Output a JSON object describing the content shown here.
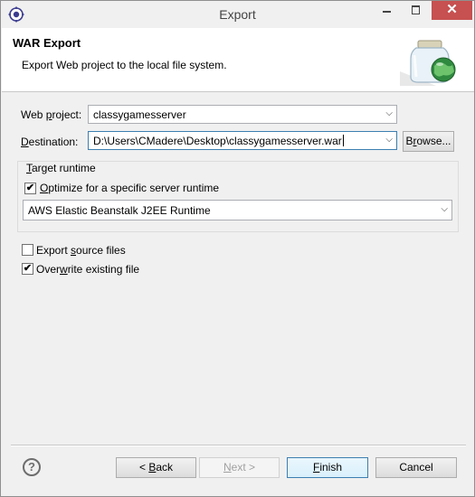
{
  "window": {
    "title": "Export",
    "close_symbol": "✕"
  },
  "banner": {
    "title": "WAR Export",
    "description": "Export Web project to the local file system."
  },
  "form": {
    "web_project": {
      "label_pre": "Web ",
      "label_u": "p",
      "label_post": "roject:",
      "value": "classygamesserver"
    },
    "destination": {
      "label_pre": "",
      "label_u": "D",
      "label_post": "estination:",
      "value": "D:\\Users\\CMadere\\Desktop\\classygamesserver.war",
      "browse_pre": "B",
      "browse_u": "r",
      "browse_post": "owse..."
    },
    "target_runtime": {
      "group_pre": "",
      "group_u": "T",
      "group_post": "arget runtime",
      "optimize_pre": "",
      "optimize_u": "O",
      "optimize_post": "ptimize for a specific server runtime",
      "optimize_checked": true,
      "runtime_value": "AWS Elastic Beanstalk J2EE Runtime"
    },
    "export_source": {
      "pre": "Export ",
      "u": "s",
      "post": "ource files",
      "checked": false
    },
    "overwrite": {
      "pre": "Over",
      "u": "w",
      "post": "rite existing file",
      "checked": true
    }
  },
  "buttons": {
    "help": "?",
    "back_pre": "< ",
    "back_u": "B",
    "back_post": "ack",
    "next_pre": "",
    "next_u": "N",
    "next_post": "ext >",
    "finish_pre": "",
    "finish_u": "F",
    "finish_post": "inish",
    "cancel": "Cancel"
  },
  "check_mark": "✔"
}
